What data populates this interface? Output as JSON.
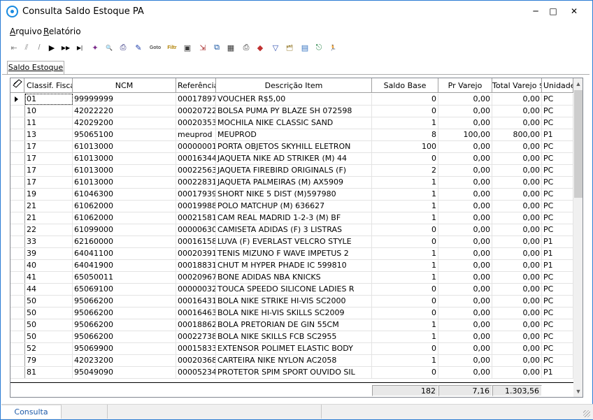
{
  "window": {
    "title": "Consulta Saldo Estoque PA",
    "minimize": "─",
    "maximize": "□",
    "close": "✕"
  },
  "menu": [
    {
      "label": "Arquivo",
      "u": "A",
      "rest": "rquivo"
    },
    {
      "label": "Relatório",
      "u": "R",
      "rest": "elatório"
    }
  ],
  "toolbar": [
    {
      "name": "first-record-icon",
      "glyph": "⇤"
    },
    {
      "name": "prior-page-icon",
      "glyph": "⫽"
    },
    {
      "name": "prior-record-icon",
      "glyph": "/"
    },
    {
      "name": "play-icon",
      "glyph": "▶"
    },
    {
      "name": "next-page-icon",
      "glyph": "▶▶"
    },
    {
      "name": "last-record-icon",
      "glyph": "▶|"
    },
    {
      "name": "sparkle-icon",
      "glyph": "✦"
    },
    {
      "name": "preview-icon",
      "glyph": "🔍"
    },
    {
      "name": "print-icon",
      "glyph": "⎙"
    },
    {
      "name": "pen-icon",
      "glyph": "✎"
    },
    {
      "name": "goto-icon",
      "glyph": "Goto"
    },
    {
      "name": "filter-icon",
      "glyph": "Filtr"
    },
    {
      "name": "monitor-icon",
      "glyph": "▣"
    },
    {
      "name": "export-icon",
      "glyph": "⇲"
    },
    {
      "name": "copy-icon",
      "glyph": "⧉"
    },
    {
      "name": "table-icon",
      "glyph": "▦"
    },
    {
      "name": "printer2-icon",
      "glyph": "⎙"
    },
    {
      "name": "shapes-icon",
      "glyph": "◆"
    },
    {
      "name": "funnel-icon",
      "glyph": "▽"
    },
    {
      "name": "folder-icon",
      "glyph": "🗂"
    },
    {
      "name": "screen-icon",
      "glyph": "▤"
    },
    {
      "name": "door-icon",
      "glyph": "⎋"
    },
    {
      "name": "exit-icon",
      "glyph": "🏃"
    }
  ],
  "tab": {
    "label": "Saldo Estoque"
  },
  "columns": [
    "Classif. Fiscal",
    "NCM",
    "Referência",
    "Descrição Item",
    "Saldo Base",
    "Pr Varejo",
    "Total Varejo $",
    "Unidade"
  ],
  "rows": [
    [
      "01",
      "99999999",
      "00017897",
      "VOUCHER R$5,00",
      "0",
      "0,00",
      "0,00",
      "PC"
    ],
    [
      "10",
      "42022220",
      "00020722",
      "BOLSA PUMA PY BLAZE SH 072598",
      "0",
      "0,00",
      "0,00",
      "PC"
    ],
    [
      "11",
      "42029200",
      "00020353",
      "MOCHILA NIKE CLASSIC SAND",
      "1",
      "0,00",
      "0,00",
      "PC"
    ],
    [
      "13",
      "95065100",
      "meuprod",
      "MEUPROD",
      "8",
      "100,00",
      "800,00",
      "P1"
    ],
    [
      "17",
      "61013000",
      "00000001",
      "PORTA OBJETOS SKYHILL ELETRON",
      "100",
      "0,00",
      "0,00",
      "PC"
    ],
    [
      "17",
      "61013000",
      "00016344",
      "JAQUETA NIKE AD STRIKER (M) 44",
      "0",
      "0,00",
      "0,00",
      "PC"
    ],
    [
      "17",
      "61013000",
      "00022563",
      "JAQUETA FIREBIRD ORIGINALS (F)",
      "2",
      "0,00",
      "0,00",
      "PC"
    ],
    [
      "17",
      "61013000",
      "00022831",
      "JAQUETA PALMEIRAS (M) AX5909",
      "1",
      "0,00",
      "0,00",
      "PC"
    ],
    [
      "19",
      "61046300",
      "00017939",
      "SHORT NIKE 5 DIST (M)597980",
      "1",
      "0,00",
      "0,00",
      "PC"
    ],
    [
      "21",
      "61062000",
      "00019988",
      "POLO MATCHUP (M) 636627",
      "1",
      "0,00",
      "0,00",
      "PC"
    ],
    [
      "21",
      "61062000",
      "00021581",
      "CAM REAL MADRID 1-2-3 (M) BF",
      "1",
      "0,00",
      "0,00",
      "PC"
    ],
    [
      "22",
      "61099000",
      "00000630",
      "CAMISETA ADIDAS (F) 3 LISTRAS",
      "0",
      "0,00",
      "0,00",
      "PC"
    ],
    [
      "33",
      "62160000",
      "00016158",
      "LUVA (F) EVERLAST VELCRO STYLE",
      "0",
      "0,00",
      "0,00",
      "P1"
    ],
    [
      "39",
      "64041100",
      "00020391",
      "TENIS MIZUNO F WAVE IMPETUS 2",
      "1",
      "0,00",
      "0,00",
      "P1"
    ],
    [
      "40",
      "64041900",
      "00018831",
      "CHUT M HYPER PHADE IC 599810",
      "1",
      "0,00",
      "0,00",
      "P1"
    ],
    [
      "41",
      "65050011",
      "00020967",
      "BONE ADIDAS NBA KNICKS",
      "1",
      "0,00",
      "0,00",
      "PC"
    ],
    [
      "44",
      "65069100",
      "00000032",
      "TOUCA SPEEDO SILICONE LADIES R",
      "0",
      "0,00",
      "0,00",
      "PC"
    ],
    [
      "50",
      "95066200",
      "00016431",
      "BOLA NIKE STRIKE HI-VIS SC2000",
      "0",
      "0,00",
      "0,00",
      "PC"
    ],
    [
      "50",
      "95066200",
      "00016463",
      "BOLA NIKE HI-VIS SKILLS SC2009",
      "0",
      "0,00",
      "0,00",
      "PC"
    ],
    [
      "50",
      "95066200",
      "00018862",
      "BOLA PRETORIAN DE GIN 55CM",
      "1",
      "0,00",
      "0,00",
      "PC"
    ],
    [
      "50",
      "95066200",
      "00022738",
      "BOLA NIKE SKILLS FCB SC2955",
      "1",
      "0,00",
      "0,00",
      "PC"
    ],
    [
      "52",
      "95069900",
      "00015833",
      "EXTENSOR POLIMET ELASTIC BODY",
      "0",
      "0,00",
      "0,00",
      "PC"
    ],
    [
      "79",
      "42023200",
      "00020368",
      "CARTEIRA NIKE NYLON AC2058",
      "1",
      "0,00",
      "0,00",
      "PC"
    ],
    [
      "81",
      "95049090",
      "00005234",
      "PROTETOR SPIM SPORT OUVIDO SIL",
      "0",
      "0,00",
      "0,00",
      "P1"
    ]
  ],
  "totals": {
    "saldo_base": "182",
    "pr_varejo": "7,16",
    "total_varejo": "1.303,56"
  },
  "status": {
    "panel1": "Consulta"
  },
  "colors": {
    "accent": "#2b7cd3",
    "status_text": "#1e5aa8"
  }
}
